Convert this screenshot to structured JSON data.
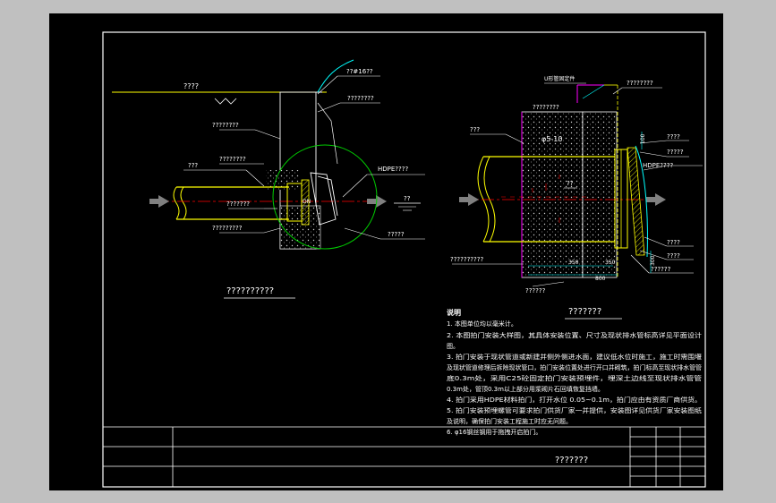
{
  "drawing": {
    "left_view_title": "??????????",
    "right_view_title": "???????",
    "title_block_name": "???????"
  },
  "left_view": {
    "ground_label": "????",
    "rebar_label": "??#16??",
    "rebar_note": "????????",
    "wall_label": "????????",
    "pipe_label": "???",
    "pipe_note": "????????",
    "fill_label": "???????",
    "base_label": "?????????",
    "gate_label": "HDPE????",
    "sweep_label": "?????",
    "water_label": "??"
  },
  "right_view": {
    "top_note": "U形管固定件",
    "top_label": "????????",
    "wall_label": "????????",
    "pipe_label": "???",
    "rebar_label": "φ5-10",
    "dim_label_1": "????",
    "gate_label": "HDPE????",
    "side_label_1": "????",
    "side_label_2": "?????",
    "side_label_3": "????",
    "side_label_4": "??????",
    "anchor_label": "??",
    "bottom_label": "??????????",
    "base_note": "??????",
    "dim_350a": "350",
    "dim_350b": "350",
    "dim_800": "800",
    "dim_100": "100",
    "dim_300": "300"
  },
  "notes": {
    "heading": "说明",
    "lines": [
      "1. 本图单位均以毫米计。",
      "2. 本图拍门安装大样图，其具体安装位置、尺寸及现状排水管标高详见平面设计",
      "图。",
      "3. 拍门安装于现状管道或新建并侧外侧进水面，建议低水位时施工，施工时需围堰",
      "及现状管道修理后拆除现状管口，拍门安装位置处进行开口并砌筑，拍门标高至现状排水管管",
      "底0.3m处，采用C25砼固定拍门安装预埋件，埋深土边线至现状排水管管",
      "0.3m处，管顶0.3m以上部分用浆砌片石回填恢复挡墙。",
      "4. 拍门采用HDPE材料拍门，打开水位 0.05~0.1m，拍门应由有资质厂商供货。",
      "5. 拍门安装预埋螺管可要求拍门供货厂家一并提供，安装图详见供货厂家安装图纸",
      "及说明，确保拍门安装工程施工时应无问题。",
      "6. φ16钢丝钢用于拖拽开启拍门。"
    ]
  },
  "colors": {
    "frame": "#ffffff",
    "pipe": "#ffff00",
    "callout": "#ffffff",
    "circle": "#00cc00",
    "section_line": "#ff00ff",
    "center_line": "#ff0000",
    "flow_arrow": "#808080",
    "dimension": "#00ffff",
    "fill": "#bdbdbd",
    "cyan_line": "#00ffff"
  }
}
